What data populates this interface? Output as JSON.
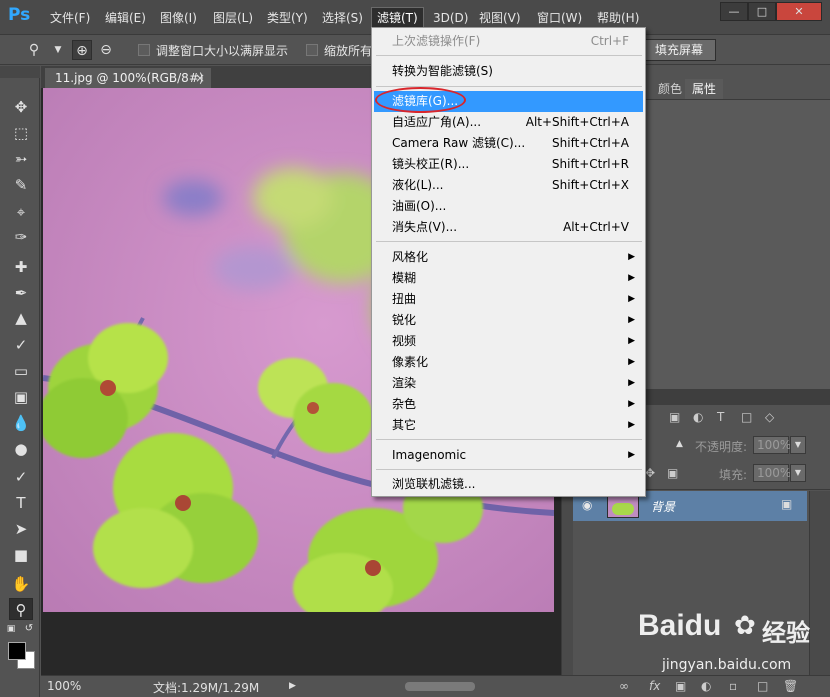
{
  "app": {
    "logo": "Ps"
  },
  "menubar": {
    "items": [
      "文件(F)",
      "编辑(E)",
      "图像(I)",
      "图层(L)",
      "类型(Y)",
      "选择(S)",
      "滤镜(T)",
      "3D(D)",
      "视图(V)",
      "窗口(W)",
      "帮助(H)"
    ],
    "active": "滤镜(T)"
  },
  "options": {
    "resize_label": "调整窗口大小以满屏显示",
    "zoom_all_label": "缩放所有",
    "fill_screen_label": "填充屏幕"
  },
  "document": {
    "tab_title": "11.jpg @ 100%(RGB/8#)",
    "zoom": "100%",
    "doc_size": "文档:1.29M/1.29M"
  },
  "panels": {
    "tabs": [
      "颜色",
      "属性"
    ],
    "active_tab": "属性",
    "opacity_label": "不透明度:",
    "opacity_value": "100%",
    "fill_label": "填充:",
    "fill_value": "100%",
    "layer_name": "背景"
  },
  "filter_menu": {
    "last_filter": {
      "label": "上次滤镜操作(F)",
      "shortcut": "Ctrl+F"
    },
    "smart": "转换为智能滤镜(S)",
    "group1": [
      {
        "label": "滤镜库(G)...",
        "shortcut": ""
      },
      {
        "label": "自适应广角(A)...",
        "shortcut": "Alt+Shift+Ctrl+A"
      },
      {
        "label": "Camera Raw 滤镜(C)...",
        "shortcut": "Shift+Ctrl+A"
      },
      {
        "label": "镜头校正(R)...",
        "shortcut": "Shift+Ctrl+R"
      },
      {
        "label": "液化(L)...",
        "shortcut": "Shift+Ctrl+X"
      },
      {
        "label": "油画(O)...",
        "shortcut": ""
      },
      {
        "label": "消失点(V)...",
        "shortcut": "Alt+Ctrl+V"
      }
    ],
    "group2": [
      "风格化",
      "模糊",
      "扭曲",
      "锐化",
      "视频",
      "像素化",
      "渲染",
      "杂色",
      "其它"
    ],
    "plugin": "Imagenomic",
    "browse": "浏览联机滤镜..."
  },
  "watermark": {
    "brand": "Baidu",
    "sub": "经验",
    "url": "jingyan.baidu.com"
  }
}
